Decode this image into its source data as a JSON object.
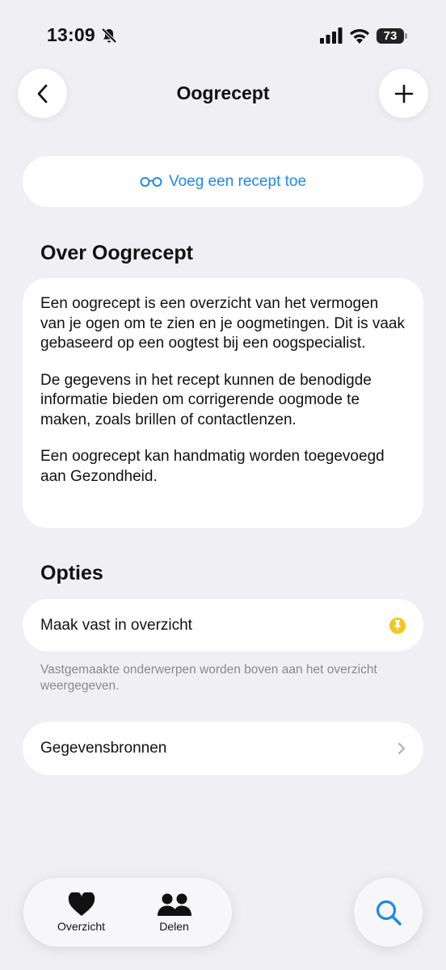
{
  "status_bar": {
    "time": "13:09",
    "battery": "73"
  },
  "nav": {
    "title": "Oogrecept"
  },
  "add_recipe": {
    "label": "Voeg een recept toe",
    "icon": "glasses-icon",
    "accent": "#1e88e5"
  },
  "about": {
    "title": "Over Oogrecept",
    "paragraphs": [
      "Een oogrecept is een overzicht van het vermogen van je ogen om te zien en je oogmetingen. Dit is vaak gebaseerd op een oogtest bij een oogspecialist.",
      "De gegevens in het recept kunnen de benodigde informatie bieden om corrigerende oogmode te maken, zoals brillen of contactlenzen.",
      "Een oogrecept kan handmatig worden toegevoegd aan Gezondheid."
    ]
  },
  "options": {
    "title": "Opties",
    "pin_label": "Maak vast in overzicht",
    "pin_color": "#f5c518",
    "pin_note": "Vastgemaakte onderwerpen worden boven aan het overzicht weergegeven.",
    "sources_label": "Gegevensbronnen"
  },
  "tab_bar": {
    "tabs": [
      {
        "label": "Overzicht",
        "icon": "heart-icon"
      },
      {
        "label": "Delen",
        "icon": "people-icon"
      }
    ],
    "search_icon": "search-icon"
  }
}
